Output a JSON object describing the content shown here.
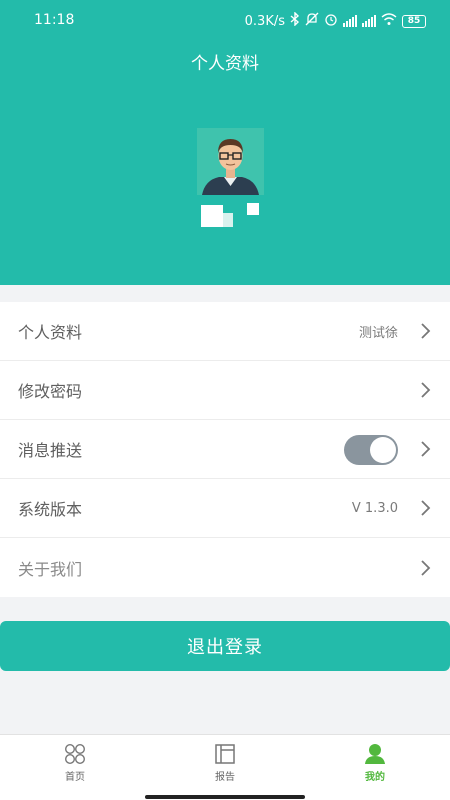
{
  "status_bar": {
    "time": "11:18",
    "network_speed": "0.3K/s",
    "battery": "85",
    "icons": [
      "bluetooth-icon",
      "mute-icon",
      "alarm-icon",
      "signal-hd-icon",
      "signal-hd-icon",
      "wifi-icon",
      "battery-icon"
    ]
  },
  "header": {
    "title": "个人资料",
    "background_color": "#23bbaa"
  },
  "menu": {
    "items": [
      {
        "label": "个人资料",
        "value": "测试徐"
      },
      {
        "label": "修改密码",
        "value": ""
      },
      {
        "label": "消息推送",
        "value": "",
        "toggle_on": true
      },
      {
        "label": "系统版本",
        "value": "V 1.3.0"
      },
      {
        "label": "关于我们",
        "value": ""
      }
    ]
  },
  "logout": {
    "label": "退出登录"
  },
  "tabbar": {
    "tabs": [
      {
        "label": "首页",
        "icon": "home-grid-icon"
      },
      {
        "label": "报告",
        "icon": "report-icon"
      },
      {
        "label": "我的",
        "icon": "profile-icon",
        "active": true
      }
    ],
    "active_color": "#52b83e"
  }
}
